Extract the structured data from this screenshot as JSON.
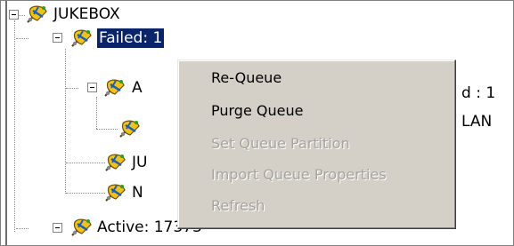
{
  "tree": {
    "root": {
      "label": "JUKEBOX",
      "icon": "satellite-icon"
    },
    "nodes": [
      {
        "label": "Failed: 1",
        "selected": true
      },
      {
        "label": "A"
      },
      {
        "label": "JU"
      },
      {
        "label": "N"
      },
      {
        "label": "Active: 17373"
      }
    ],
    "partial_right": [
      {
        "text": "d : 1"
      },
      {
        "text": "LAN"
      }
    ]
  },
  "context_menu": {
    "items": [
      {
        "label": "Re-Queue",
        "enabled": true
      },
      {
        "label": "Purge Queue",
        "enabled": true
      },
      {
        "label": "Set Queue Partition",
        "enabled": false
      },
      {
        "label": "Import Queue Properties",
        "enabled": false
      },
      {
        "label": "Refresh",
        "enabled": false
      }
    ]
  },
  "colors": {
    "selection": "#0a246a",
    "menu_background": "#d4d0c8",
    "disabled_text": "#a7a49d"
  }
}
